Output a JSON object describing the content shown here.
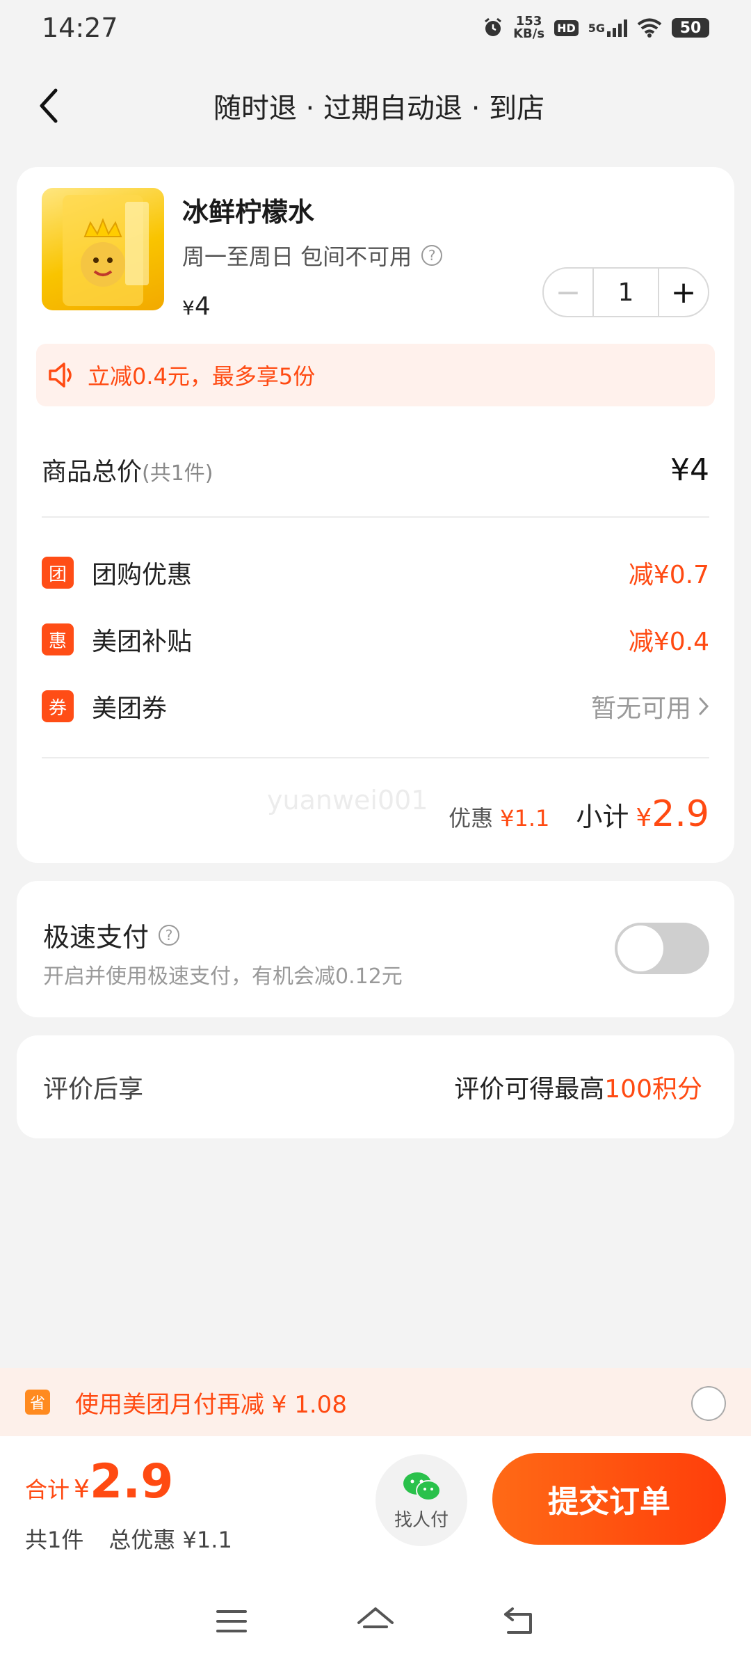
{
  "status_bar": {
    "time": "14:27",
    "net_speed_value": "153",
    "net_speed_unit": "KB/s",
    "hd": "HD",
    "signal": "5G",
    "battery": "50",
    "icons": [
      "alarm-icon",
      "wifi-icon",
      "signal-icon",
      "battery-icon"
    ]
  },
  "nav": {
    "title": "随时退 · 过期自动退 · 到店"
  },
  "product": {
    "name": "冰鲜柠檬水",
    "rule": "周一至周日 包间不可用",
    "price_symbol": "¥",
    "price": "4",
    "quantity": "1",
    "minus": "−",
    "plus": "+"
  },
  "promo": {
    "text": "立减0.4元，最多享5份"
  },
  "summary": {
    "total_label": "商品总价",
    "total_count": "(共1件)",
    "total_value": "¥4",
    "discounts": [
      {
        "icon": "团",
        "label": "团购优惠",
        "value": "减¥0.7"
      },
      {
        "icon": "惠",
        "label": "美团补贴",
        "value": "减¥0.4"
      },
      {
        "icon": "券",
        "label": "美团券",
        "value": "暂无可用"
      }
    ],
    "watermark": "yuanwei001",
    "saving_label": "优惠",
    "saving_value": "¥1.1",
    "subtotal_label": "小计",
    "subtotal_symbol": "¥",
    "subtotal_value": "2.9"
  },
  "fast_pay": {
    "title": "极速支付",
    "desc": "开启并使用极速支付，有机会减0.12元",
    "enabled": false
  },
  "review": {
    "label": "评价后享",
    "text_prefix": "评价可得最高",
    "text_highlight": "100积分"
  },
  "monthly_pay": {
    "icon": "省",
    "text": "使用美团月付再减 ¥ 1.08",
    "checked": false
  },
  "checkout": {
    "sum_label": "合计",
    "sum_symbol": "¥",
    "sum_value": "2.9",
    "count": "共1件",
    "total_saving": "总优惠 ¥1.1",
    "friend_pay": "找人付",
    "submit": "提交订单"
  },
  "colors": {
    "accent": "#ff4a12",
    "background": "#f3f3f3",
    "card": "#ffffff"
  }
}
